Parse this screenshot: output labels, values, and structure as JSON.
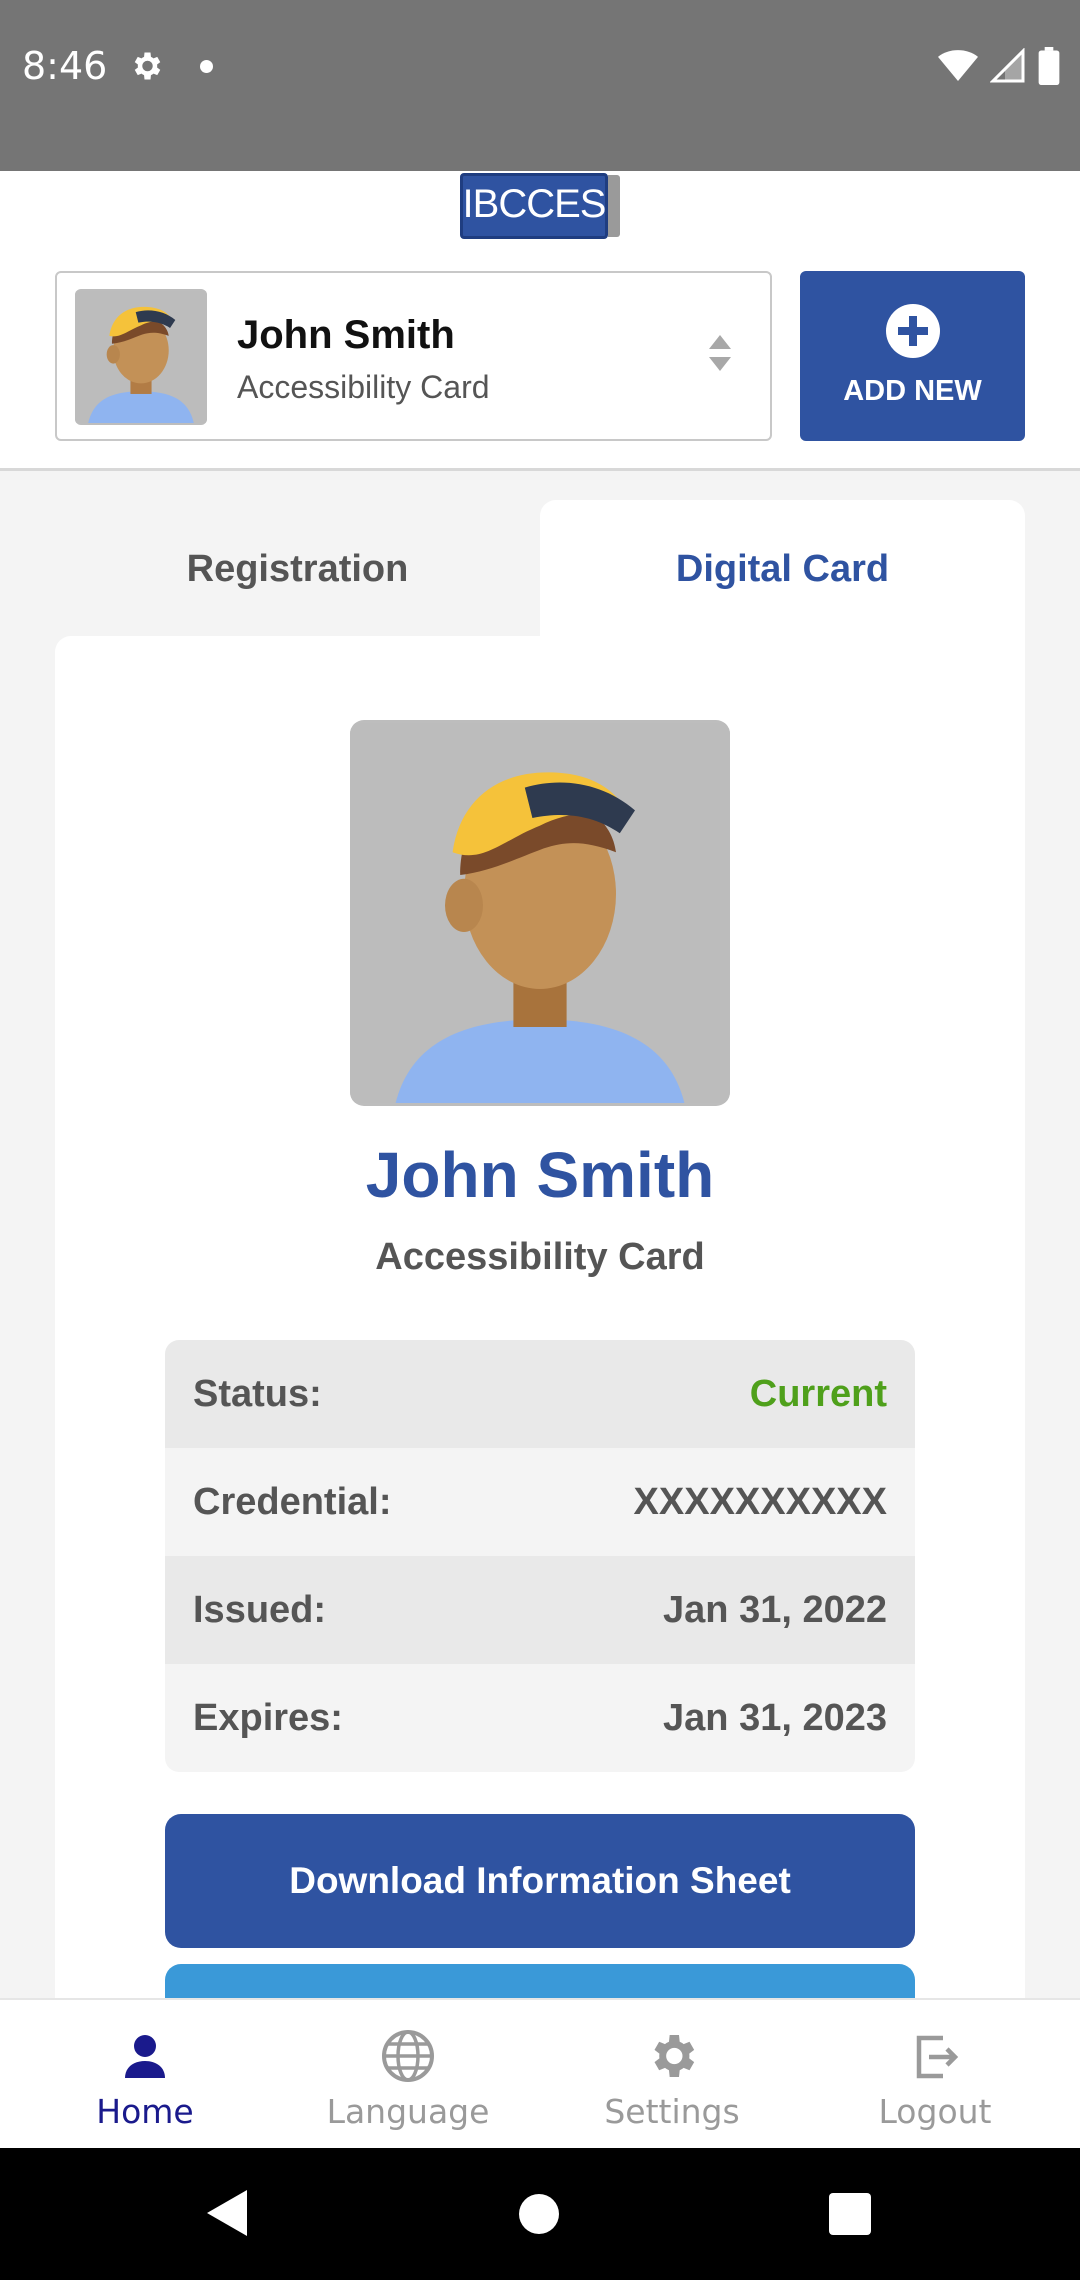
{
  "status_bar": {
    "time": "8:46",
    "icons": [
      "gear-icon",
      "dot-icon",
      "wifi-icon",
      "cell-signal-icon",
      "battery-icon"
    ]
  },
  "header": {
    "logo_text": "IBCCES",
    "profile": {
      "name": "John Smith",
      "card_type": "Accessibility Card"
    },
    "add_new_label": "ADD NEW"
  },
  "tabs": [
    {
      "label": "Registration",
      "active": false
    },
    {
      "label": "Digital Card",
      "active": true
    }
  ],
  "card": {
    "name": "John Smith",
    "card_type": "Accessibility Card",
    "rows": [
      {
        "label": "Status:",
        "value": "Current"
      },
      {
        "label": "Credential:",
        "value": "XXXXXXXXXX"
      },
      {
        "label": "Issued:",
        "value": "Jan 31, 2022"
      },
      {
        "label": "Expires:",
        "value": "Jan 31, 2023"
      }
    ],
    "download_button": "Download Information Sheet"
  },
  "bottom_nav": [
    {
      "label": "Home",
      "icon": "person-icon",
      "active": true
    },
    {
      "label": "Language",
      "icon": "globe-icon",
      "active": false
    },
    {
      "label": "Settings",
      "icon": "gear-icon",
      "active": false
    },
    {
      "label": "Logout",
      "icon": "logout-icon",
      "active": false
    }
  ],
  "colors": {
    "brand_blue": "#2f53a1",
    "status_green": "#4fa01b",
    "light_blue": "#3a99d8",
    "active_nav": "#1a1a8c"
  }
}
